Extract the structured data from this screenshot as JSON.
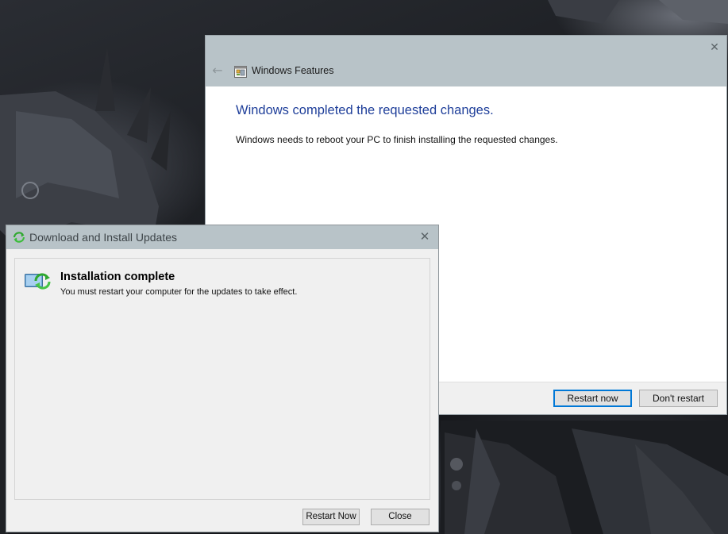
{
  "windows_features": {
    "title": "Windows Features",
    "heading": "Windows completed the requested changes.",
    "message": "Windows needs to reboot your PC to finish installing the requested changes.",
    "restart_label": "Restart now",
    "dont_restart_label": "Don't restart",
    "close_glyph": "✕",
    "back_glyph": "←",
    "accent_color": "#0078d7",
    "heading_color": "#1f3f9a",
    "titlebar_color": "#b8c3c8"
  },
  "update_dialog": {
    "title": "Download and Install Updates",
    "heading": "Installation complete",
    "message": "You must restart your computer for the updates to take effect.",
    "restart_label": "Restart Now",
    "close_label": "Close",
    "close_glyph": "✕",
    "icon": "windows-update-icon"
  }
}
